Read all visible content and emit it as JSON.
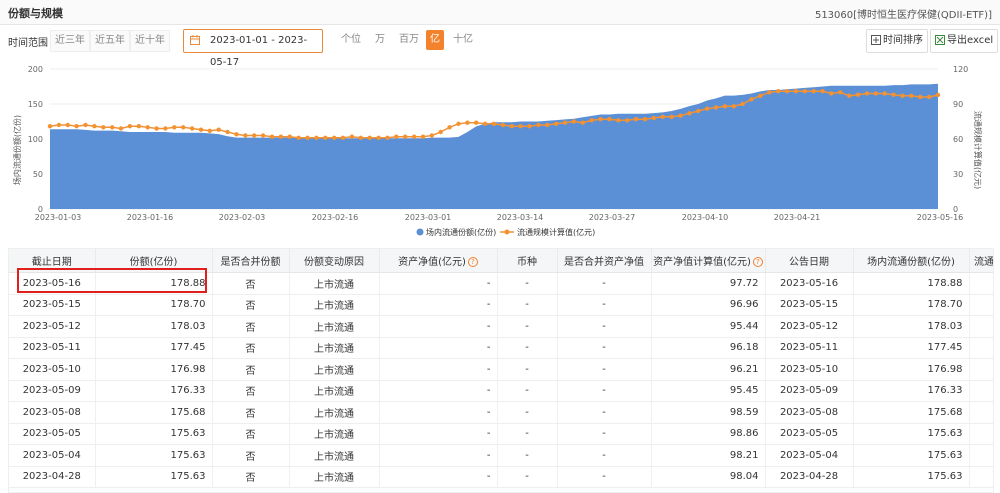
{
  "header": {
    "title": "份额与规模",
    "fund": "513060[博时恒生医疗保健(QDII-ETF)]"
  },
  "controls": {
    "time_label": "时间范围",
    "ranges": [
      "近三年",
      "近五年",
      "近十年"
    ],
    "date_range": "2023-01-01  -  2023-05-17",
    "units": [
      "个位",
      "万",
      "百万",
      "亿",
      "十亿"
    ],
    "active_unit": "亿",
    "sort_label": "时间排序",
    "export_label": "导出excel"
  },
  "chart_data": {
    "type": "area",
    "x_ticks": [
      "2023-01-03",
      "2023-01-16",
      "2023-02-03",
      "2023-02-16",
      "2023-03-01",
      "2023-03-14",
      "2023-03-27",
      "2023-04-10",
      "2023-04-21",
      "2023-05-16"
    ],
    "ylabel_left": "场内流通份额(亿份)",
    "ylabel_right": "流通规模计算值(亿元)",
    "ylim_left": [
      0,
      200
    ],
    "ylim_right": [
      0,
      120
    ],
    "yticks_left": [
      "200",
      "150",
      "100",
      "50",
      "0"
    ],
    "yticks_right": [
      "120",
      "90",
      "60",
      "30",
      "0"
    ],
    "legend": [
      "场内流通份额(亿份)",
      "流通规模计算值(亿元)"
    ],
    "legend_position": "bottom",
    "colors": {
      "area": "#5b8fd6",
      "line": "#f39233"
    },
    "series": [
      {
        "name": "场内流通份额(亿份)",
        "values": [
          114,
          114,
          114,
          114,
          113,
          112,
          112,
          112,
          111,
          110,
          110,
          110,
          110,
          110,
          109,
          109,
          109,
          109,
          108,
          107,
          104,
          102,
          102,
          102,
          102,
          102,
          102,
          102,
          102,
          102,
          101,
          101,
          101,
          101,
          101,
          101,
          101,
          101,
          101,
          101,
          101,
          101,
          101,
          102,
          102,
          102,
          103,
          110,
          118,
          122,
          124,
          124,
          124,
          125,
          125,
          125,
          126,
          127,
          128,
          129,
          131,
          133,
          135,
          135,
          136,
          136,
          136,
          136,
          137,
          138,
          140,
          143,
          147,
          150,
          155,
          158,
          162,
          162,
          163,
          165,
          168,
          170,
          170,
          171,
          172,
          173,
          174,
          175,
          176,
          176,
          176,
          176,
          176,
          176,
          176,
          177,
          177,
          178,
          178,
          178,
          178.88
        ]
      },
      {
        "name": "流通规模计算值(亿元)",
        "values": [
          71,
          72,
          72,
          71,
          72,
          71,
          70,
          70,
          69,
          71,
          71,
          70,
          69,
          69,
          70,
          70,
          69,
          68,
          67,
          68,
          66,
          64,
          63,
          63,
          63,
          62,
          62,
          62,
          61,
          61,
          61,
          61,
          61,
          61,
          62,
          61,
          61,
          61,
          61,
          62,
          62,
          62,
          62,
          63,
          66,
          70,
          73,
          74,
          74,
          73,
          73,
          72,
          71,
          71,
          71,
          72,
          72,
          73,
          74,
          75,
          74,
          76,
          77,
          77,
          76,
          76,
          77,
          77,
          78,
          79,
          79,
          80,
          82,
          84,
          86,
          87,
          88,
          88,
          90,
          94,
          97,
          100,
          101,
          101,
          101,
          101,
          101,
          101,
          99,
          100,
          97,
          98,
          99,
          99,
          99,
          98,
          97,
          97,
          96,
          96,
          97.72
        ]
      }
    ]
  },
  "table": {
    "headers": [
      "截止日期",
      "份额(亿份)",
      "是否合并份额",
      "份额变动原因",
      "资产净值(亿元)",
      "币种",
      "是否合并资产净值",
      "资产净值计算值(亿元)",
      "公告日期",
      "场内流通份额(亿份)",
      "流通规"
    ],
    "rows": [
      [
        "2023-05-16",
        "178.88",
        "否",
        "上市流通",
        "-",
        "-",
        "-",
        "97.72",
        "2023-05-16",
        "178.88",
        ""
      ],
      [
        "2023-05-15",
        "178.70",
        "否",
        "上市流通",
        "-",
        "-",
        "-",
        "96.96",
        "2023-05-15",
        "178.70",
        ""
      ],
      [
        "2023-05-12",
        "178.03",
        "否",
        "上市流通",
        "-",
        "-",
        "-",
        "95.44",
        "2023-05-12",
        "178.03",
        ""
      ],
      [
        "2023-05-11",
        "177.45",
        "否",
        "上市流通",
        "-",
        "-",
        "-",
        "96.18",
        "2023-05-11",
        "177.45",
        ""
      ],
      [
        "2023-05-10",
        "176.98",
        "否",
        "上市流通",
        "-",
        "-",
        "-",
        "96.21",
        "2023-05-10",
        "176.98",
        ""
      ],
      [
        "2023-05-09",
        "176.33",
        "否",
        "上市流通",
        "-",
        "-",
        "-",
        "95.45",
        "2023-05-09",
        "176.33",
        ""
      ],
      [
        "2023-05-08",
        "175.68",
        "否",
        "上市流通",
        "-",
        "-",
        "-",
        "98.59",
        "2023-05-08",
        "175.68",
        ""
      ],
      [
        "2023-05-05",
        "175.63",
        "否",
        "上市流通",
        "-",
        "-",
        "-",
        "98.86",
        "2023-05-05",
        "175.63",
        ""
      ],
      [
        "2023-05-04",
        "175.63",
        "否",
        "上市流通",
        "-",
        "-",
        "-",
        "98.21",
        "2023-05-04",
        "175.63",
        ""
      ],
      [
        "2023-04-28",
        "175.63",
        "否",
        "上市流通",
        "-",
        "-",
        "-",
        "98.04",
        "2023-04-28",
        "175.63",
        ""
      ]
    ]
  }
}
